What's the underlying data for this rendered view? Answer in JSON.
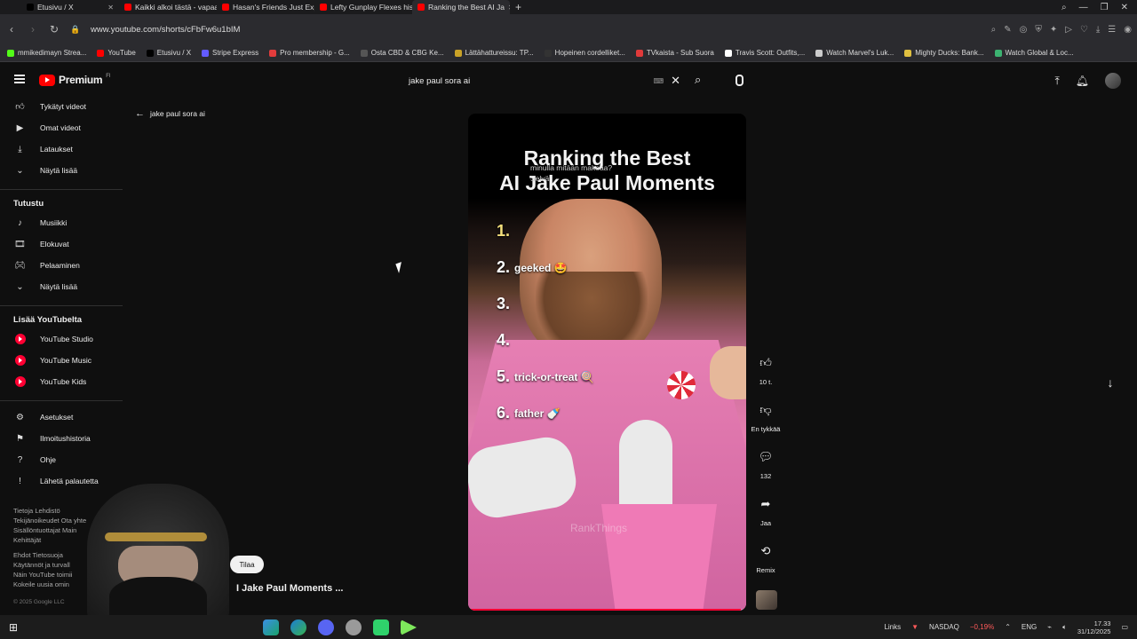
{
  "browser": {
    "tabs": [
      {
        "label": "Etusivu / X",
        "color": "#000000"
      },
      {
        "label": "Kaikki alkoi tästä - vapaao",
        "color": "#ff0000"
      },
      {
        "label": "Hasan's Friends Just Expo",
        "color": "#ff0000"
      },
      {
        "label": "Lefty Gunplay Flexes his C",
        "color": "#ff0000"
      },
      {
        "label": "Ranking the Best AI Ja",
        "color": "#ff0000",
        "active": true
      }
    ],
    "url": "www.youtube.com/shorts/cFbFw6u1bIM",
    "bookmarks": [
      {
        "label": "mmikedimayn Strea...",
        "color": "#53fc18"
      },
      {
        "label": "YouTube",
        "color": "#ff0000"
      },
      {
        "label": "Etusivu / X",
        "color": "#000000"
      },
      {
        "label": "Stripe Express",
        "color": "#635bff"
      },
      {
        "label": "Pro membership - G...",
        "color": "#e23c3c"
      },
      {
        "label": "Osta CBD & CBG Ke...",
        "color": "#555555"
      },
      {
        "label": "Lättähattureissu: TP...",
        "color": "#c9a227"
      },
      {
        "label": "Hopeinen cordelliket...",
        "color": "#333333"
      },
      {
        "label": "TVkaista - Sub Suora",
        "color": "#e03a3a"
      },
      {
        "label": "Travis Scott: Outfits,...",
        "color": "#ffffff"
      },
      {
        "label": "Watch Marvel's Luk...",
        "color": "#cccccc"
      },
      {
        "label": "Mighty Ducks: Bank...",
        "color": "#e0c040"
      },
      {
        "label": "Watch Global & Loc...",
        "color": "#3cb371"
      }
    ]
  },
  "header": {
    "logo_text": "Premium",
    "logo_region": "FI",
    "search_value": "jake paul sora ai"
  },
  "sidebar": {
    "items_top": [
      {
        "label": "Tykätyt videot",
        "icon": "like-icon"
      },
      {
        "label": "Omat videot",
        "icon": "video-icon"
      },
      {
        "label": "Lataukset",
        "icon": "download-icon"
      },
      {
        "label": "Näytä lisää",
        "icon": "chevron-down-icon"
      }
    ],
    "explore_title": "Tutustu",
    "explore_items": [
      {
        "label": "Musiikki",
        "icon": "music-icon"
      },
      {
        "label": "Elokuvat",
        "icon": "film-icon"
      },
      {
        "label": "Pelaaminen",
        "icon": "gaming-icon"
      },
      {
        "label": "Näytä lisää",
        "icon": "chevron-down-icon"
      }
    ],
    "more_title": "Lisää YouTubelta",
    "more_items": [
      {
        "label": "YouTube Studio"
      },
      {
        "label": "YouTube Music"
      },
      {
        "label": "YouTube Kids"
      }
    ],
    "settings_items": [
      {
        "label": "Asetukset",
        "icon": "gear-icon"
      },
      {
        "label": "Ilmoitushistoria",
        "icon": "flag-icon"
      },
      {
        "label": "Ohje",
        "icon": "help-icon"
      },
      {
        "label": "Lähetä palautetta",
        "icon": "feedback-icon"
      }
    ],
    "footer_lines": [
      "Tietoja  Lehdistö",
      "Tekijänoikeudet  Ota yhte",
      "Sisällöntuottajat  Main",
      "Kehittäjät",
      "",
      "Ehdot  Tietosuoja",
      "Käytännöt ja turvall",
      "Näin YouTube toimii",
      "Kokeile uusia omin"
    ],
    "copyright": "© 2025 Google LLC"
  },
  "back": {
    "label": "jake paul sora ai"
  },
  "video": {
    "title_line1": "Ranking the Best",
    "title_line2": "AI Jake Paul Moments",
    "caption_line1": "minulla mitään makeaa?",
    "caption_line2": "Selvä",
    "rankings": [
      {
        "n": "1.",
        "text": ""
      },
      {
        "n": "2.",
        "text": "geeked 🤩"
      },
      {
        "n": "3.",
        "text": ""
      },
      {
        "n": "4.",
        "text": ""
      },
      {
        "n": "5.",
        "text": "trick-or-treat 🍭"
      },
      {
        "n": "6.",
        "text": "father 🍼"
      }
    ],
    "watermark": "RankThings",
    "progress": 0.98,
    "short_title": "I Jake Paul Moments ...",
    "subscribe_label": "Tilaa"
  },
  "actions": [
    {
      "icon": "like-icon",
      "label": "10 t."
    },
    {
      "icon": "dislike-icon",
      "label": "En tykkää"
    },
    {
      "icon": "comment-icon",
      "label": "132"
    },
    {
      "icon": "share-icon",
      "label": "Jaa"
    },
    {
      "icon": "remix-icon",
      "label": "Remix"
    }
  ],
  "taskbar": {
    "links_label": "Links",
    "stock_name": "NASDAQ",
    "stock_change": "−0,19%",
    "lang": "ENG",
    "time": "17.33",
    "date": "31/12/2025"
  }
}
